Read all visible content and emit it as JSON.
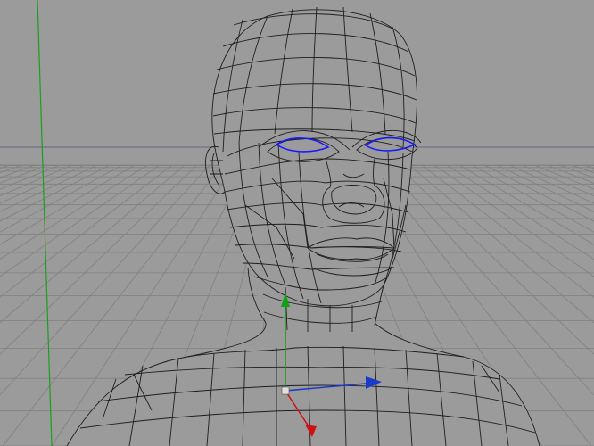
{
  "viewport": {
    "view": "perspective",
    "background_color": "#9b9b9b",
    "grid_color": "#808080",
    "horizon_color": "#5a5a8c",
    "wire_color": "#1e1e1e",
    "selection_color": "#1a1aff",
    "y_axis_line_color": "#1f9e1f"
  },
  "model": {
    "type": "head-bust-wireframe",
    "selected_parts": [
      "left-eye-loop",
      "right-eye-loop"
    ]
  },
  "gizmo": {
    "x_axis_color": "#1a3acc",
    "y_axis_color": "#10a010",
    "z_axis_color": "#d01010",
    "center_color": "#e0e0e0"
  }
}
